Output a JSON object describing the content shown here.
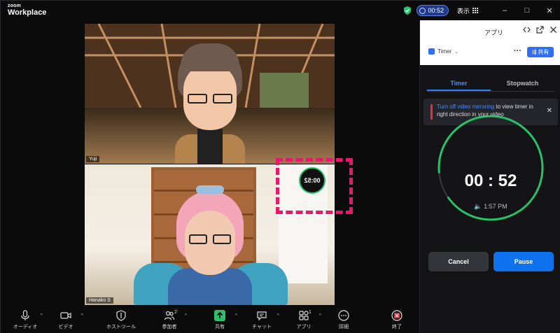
{
  "titlebar": {
    "logo_small": "zoom",
    "logo_main": "Workplace",
    "timer_pill": "00:52",
    "view_label": "表示",
    "minimize": "–",
    "maximize": "□",
    "close": "✕"
  },
  "video": {
    "participant_top": "Yuji",
    "participant_bottom": "Hanako S",
    "timer_overlay": "00:52"
  },
  "panel": {
    "title": "アプリ",
    "app_name": "Timer",
    "more": "···",
    "share_label": "共有",
    "tabs": [
      {
        "label": "Timer"
      },
      {
        "label": "Stopwatch"
      }
    ],
    "notice": {
      "link": "Turn off video mirroring",
      "text": " to view timer in right direction in your video"
    },
    "time": "00 : 52",
    "end_time": "1:57 PM",
    "cancel": "Cancel",
    "pause": "Pause",
    "accent_color": "#0e72ed",
    "ring_color": "#29c26a"
  },
  "toolbar": {
    "items": [
      {
        "label": "オーディオ",
        "icon": "microphone-icon"
      },
      {
        "label": "ビデオ",
        "icon": "video-camera-icon"
      },
      {
        "label": "ホストツール",
        "icon": "shield-icon"
      },
      {
        "label": "参加者",
        "icon": "participants-icon",
        "badge": "2"
      },
      {
        "label": "共有",
        "icon": "share-screen-icon"
      },
      {
        "label": "チャット",
        "icon": "chat-icon"
      },
      {
        "label": "アプリ",
        "icon": "apps-icon",
        "badge": "1"
      },
      {
        "label": "詳細",
        "icon": "more-icon"
      },
      {
        "label": "終了",
        "icon": "end-icon"
      }
    ]
  }
}
